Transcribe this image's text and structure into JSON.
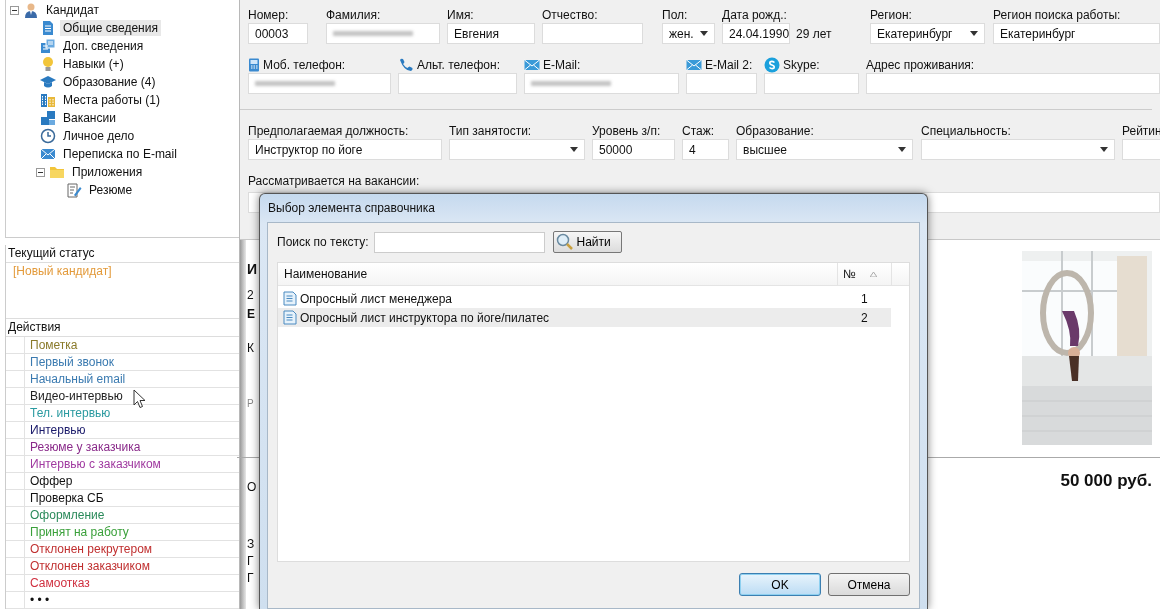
{
  "tree": [
    {
      "label": "Кандидат",
      "expanded": true,
      "selected": false,
      "children": [
        {
          "label": "Общие сведения",
          "selected": true
        },
        {
          "label": "Доп. сведения",
          "selected": false
        },
        {
          "label": "Навыки (+)",
          "selected": false
        },
        {
          "label": "Образование (4)",
          "selected": false
        },
        {
          "label": "Места работы (1)",
          "selected": false
        },
        {
          "label": "Вакансии",
          "selected": false
        },
        {
          "label": "Личное дело",
          "selected": false
        },
        {
          "label": "Переписка по E-mail",
          "selected": false
        },
        {
          "label": "Приложения",
          "expanded": true,
          "selected": false,
          "children": [
            {
              "label": "Резюме",
              "selected": false
            }
          ]
        }
      ]
    }
  ],
  "status": {
    "title": "Текущий статус",
    "value": "[Новый кандидат]"
  },
  "actions": {
    "title": "Действия",
    "items": [
      {
        "label": "Пометка",
        "color": "#8a7a2a"
      },
      {
        "label": "Первый звонок",
        "color": "#3a7ab0"
      },
      {
        "label": "Начальный email",
        "color": "#3a7ab0"
      },
      {
        "label": "Видео-интервью",
        "color": "#222222"
      },
      {
        "label": "Тел. интервью",
        "color": "#2a9aa0"
      },
      {
        "label": "Интервью",
        "color": "#1a1a6a"
      },
      {
        "label": "Резюме у заказчика",
        "color": "#8a2a8a"
      },
      {
        "label": "Интервью с заказчиком",
        "color": "#a03aa0"
      },
      {
        "label": "Оффер",
        "color": "#111111"
      },
      {
        "label": "Проверка СБ",
        "color": "#111111"
      },
      {
        "label": "Оформление",
        "color": "#2a8a5a"
      },
      {
        "label": "Принят на работу",
        "color": "#3aa03a"
      },
      {
        "label": "Отклонен рекрутером",
        "color": "#c03030"
      },
      {
        "label": "Отклонен заказчиком",
        "color": "#c03030"
      },
      {
        "label": "Самоотказ",
        "color": "#d03040"
      },
      {
        "label": "• • •",
        "color": "#111111"
      }
    ]
  },
  "form": {
    "sections": [
      {
        "fields": [
          {
            "label": "Номер:",
            "kind": "text",
            "value": "00003"
          },
          {
            "label": "Фамилия:",
            "kind": "text",
            "redacted": true
          },
          {
            "label": "Имя:",
            "kind": "text",
            "value": "Евгения"
          },
          {
            "label": "Отчество:",
            "kind": "text"
          },
          {
            "label": "Пол:",
            "kind": "select",
            "value": "жен."
          },
          {
            "label": "Дата рожд.:",
            "kind": "text",
            "value": "24.04.1990",
            "suffix": "29 лет"
          },
          {
            "label": "Регион:",
            "kind": "select",
            "value": "Екатеринбург"
          },
          {
            "label": "Регион поиска работы:",
            "kind": "text",
            "value": "Екатеринбург"
          }
        ]
      },
      {
        "fields": [
          {
            "label": "Моб. телефон:",
            "kind": "text",
            "redacted": true
          },
          {
            "label": "Альт. телефон:",
            "kind": "text"
          },
          {
            "label": "E-Mail:",
            "kind": "text",
            "redacted": true
          },
          {
            "label": "E-Mail 2:",
            "kind": "text"
          },
          {
            "label": "Skype:",
            "kind": "text"
          },
          {
            "label": "Адрес проживания:",
            "kind": "text"
          }
        ]
      },
      {
        "fields": [
          {
            "label": "Предполагаемая должность:",
            "kind": "text",
            "value": "Инструктор по йоге"
          },
          {
            "label": "Тип занятости:",
            "kind": "select"
          },
          {
            "label": "Уровень з/п:",
            "kind": "text",
            "value": "50000"
          },
          {
            "label": "Стаж:",
            "kind": "text",
            "value": "4"
          },
          {
            "label": "Образование:",
            "kind": "select",
            "value": "высшее"
          },
          {
            "label": "Специальность:",
            "kind": "select"
          },
          {
            "label": "Рейтин",
            "kind": "text"
          }
        ]
      }
    ],
    "vacancies_label": "Рассматривается на вакансии:"
  },
  "document": {
    "fragments": [
      {
        "text": "И",
        "kind": "heading"
      },
      {
        "text": "2",
        "kind": "plain"
      },
      {
        "text": "Е",
        "kind": "bold"
      },
      {
        "text": "К",
        "kind": "plain"
      },
      {
        "text": "Р",
        "kind": "small"
      },
      {
        "text": "О",
        "kind": "plain"
      },
      {
        "text": "З",
        "kind": "plain"
      },
      {
        "text": "Г",
        "kind": "plain"
      },
      {
        "text": "Г",
        "kind": "plain"
      }
    ],
    "salary": "50 000 руб."
  },
  "dialog": {
    "title": "Выбор элемента справочника",
    "search_label": "Поиск по тексту:",
    "search_button": "Найти",
    "columns": [
      "Наименование",
      "№"
    ],
    "rows": [
      {
        "name": "Опросный лист менеджера",
        "number": "1",
        "selected": false
      },
      {
        "name": "Опросный лист инструктора по йоге/пилатес",
        "number": "2",
        "selected": true
      }
    ],
    "buttons": [
      {
        "label": "OK",
        "default": true
      },
      {
        "label": "Отмена",
        "default": false
      }
    ]
  }
}
